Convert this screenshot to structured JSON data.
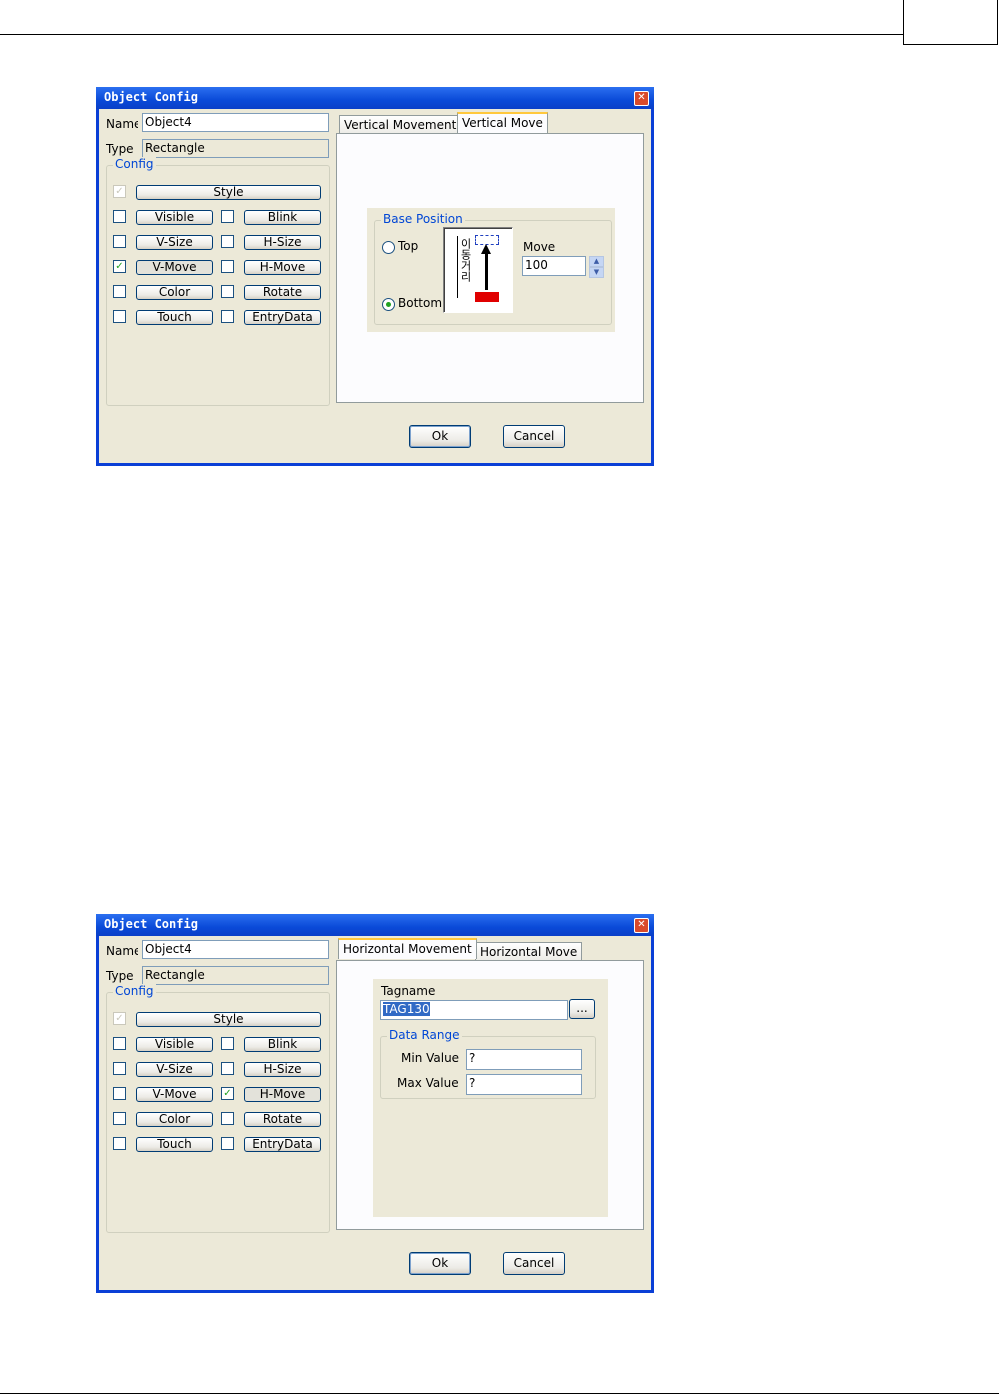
{
  "dialogs": [
    {
      "title": "Object Config",
      "name_label": "Name",
      "name_value": "Object4",
      "type_label": "Type",
      "type_value": "Rectangle",
      "config_group": "Config",
      "buttons": {
        "style": "Style",
        "visible": "Visible",
        "blink": "Blink",
        "vsize": "V-Size",
        "hsize": "H-Size",
        "vmove": "V-Move",
        "hmove": "H-Move",
        "color": "Color",
        "rotate": "Rotate",
        "touch": "Touch",
        "entrydata": "EntryData"
      },
      "checked": {
        "style": true,
        "vmove": true,
        "hmove": false
      },
      "tabs": [
        "Vertical Movement",
        "Vertical Move"
      ],
      "base_position_group": "Base Position",
      "radio_top": "Top",
      "radio_bottom": "Bottom",
      "selected_radio": "Bottom",
      "diagram_text": "이동거리",
      "move_label": "Move",
      "move_value": "100",
      "ok": "Ok",
      "cancel": "Cancel"
    },
    {
      "title": "Object Config",
      "name_label": "Name",
      "name_value": "Object4",
      "type_label": "Type",
      "type_value": "Rectangle",
      "config_group": "Config",
      "buttons": {
        "style": "Style",
        "visible": "Visible",
        "blink": "Blink",
        "vsize": "V-Size",
        "hsize": "H-Size",
        "vmove": "V-Move",
        "hmove": "H-Move",
        "color": "Color",
        "rotate": "Rotate",
        "touch": "Touch",
        "entrydata": "EntryData"
      },
      "checked": {
        "style": true,
        "vmove": false,
        "hmove": true
      },
      "tabs": [
        "Horizontal Movement",
        "Horizontal Move"
      ],
      "tagname_label": "Tagname",
      "tagname_value": "TAG130",
      "browse": "...",
      "data_range_group": "Data Range",
      "min_label": "Min Value",
      "min_value": "?",
      "max_label": "Max Value",
      "max_value": "?",
      "ok": "Ok",
      "cancel": "Cancel"
    }
  ],
  "icons": {
    "close": "close-icon",
    "check": "check-icon",
    "spin_up": "spin-up-icon",
    "spin_down": "spin-down-icon"
  }
}
